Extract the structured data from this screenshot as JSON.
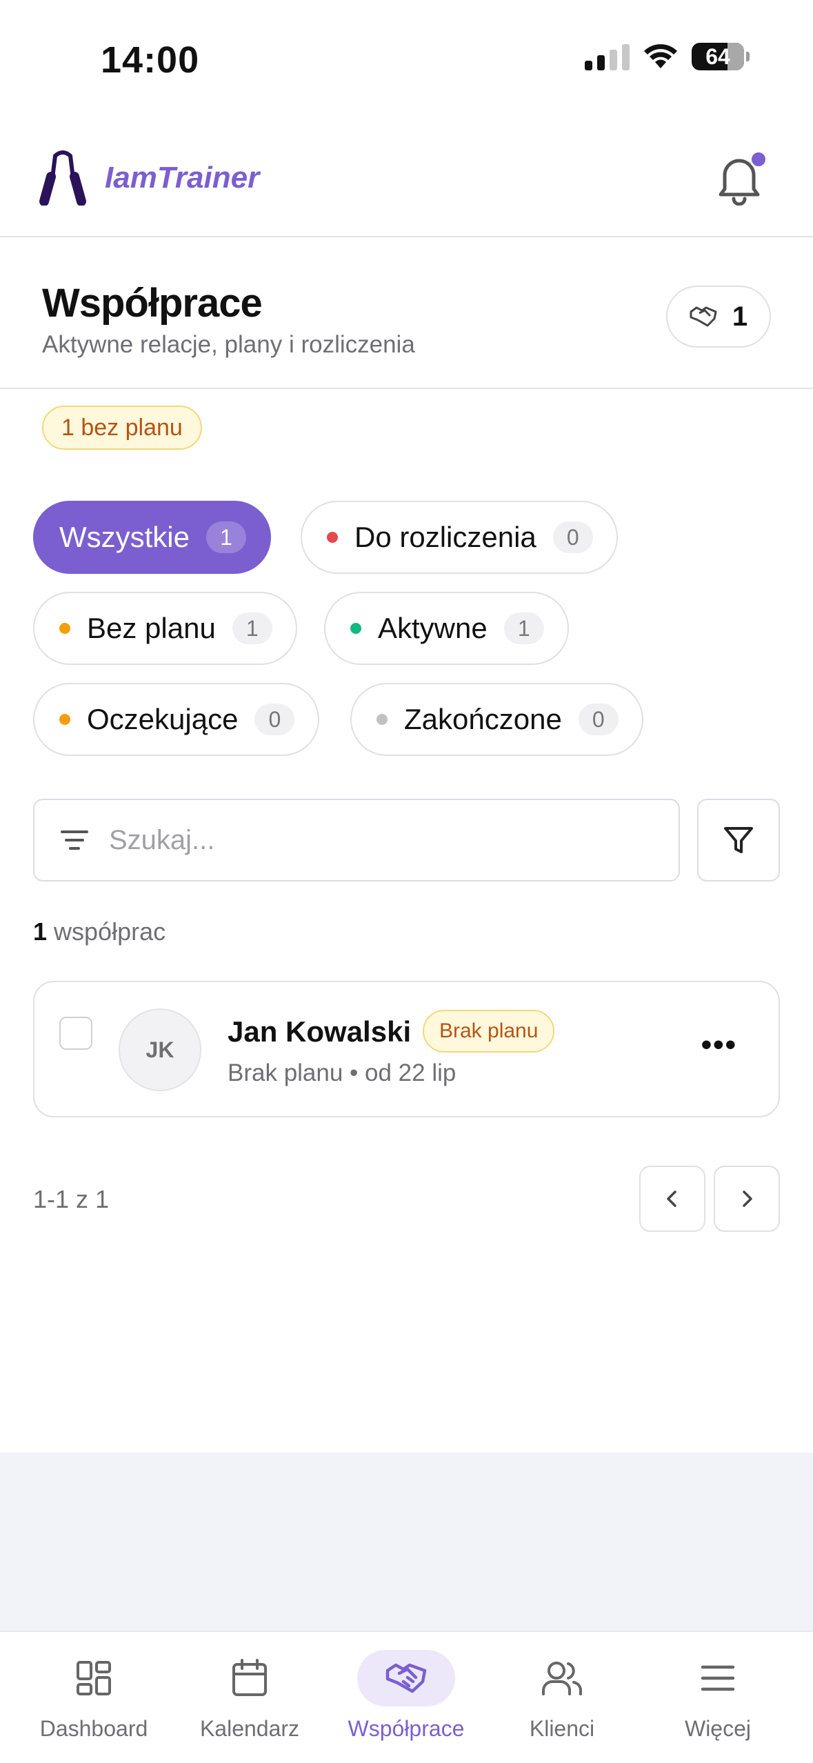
{
  "status_bar": {
    "time": "14:00",
    "battery": "64"
  },
  "app": {
    "brand": "IamTrainer",
    "notifications_unread": true,
    "accent": "#7b5fd0"
  },
  "header": {
    "title": "Współprace",
    "subtitle": "Aktywne relacje, plany i rozliczenia",
    "count": "1"
  },
  "warning_badge": "1 bez planu",
  "filters": [
    {
      "label": "Wszystkie",
      "count": "1",
      "dot": null
    },
    {
      "label": "Do rozliczenia",
      "count": "0",
      "dot": "#e5484d"
    },
    {
      "label": "Bez planu",
      "count": "1",
      "dot": "#f59e0b"
    },
    {
      "label": "Aktywne",
      "count": "1",
      "dot": "#10b981"
    },
    {
      "label": "Oczekujące",
      "count": "0",
      "dot": "#f59e0b"
    },
    {
      "label": "Zakończone",
      "count": "0",
      "dot": "#c0c0c5"
    }
  ],
  "search": {
    "placeholder": "Szukaj..."
  },
  "results": {
    "count": "1",
    "label": " współprac"
  },
  "items": [
    {
      "initials": "JK",
      "name": "Jan Kowalski",
      "badge": "Brak planu",
      "meta": "Brak planu • od 22 lip"
    }
  ],
  "pagination": {
    "text": "1-1 z 1"
  },
  "bottom_nav": [
    {
      "label": "Dashboard",
      "icon": "dashboard-grid-icon"
    },
    {
      "label": "Kalendarz",
      "icon": "calendar-icon"
    },
    {
      "label": "Współprace",
      "icon": "handshake-icon"
    },
    {
      "label": "Klienci",
      "icon": "users-icon"
    },
    {
      "label": "Więcej",
      "icon": "menu-icon"
    }
  ]
}
